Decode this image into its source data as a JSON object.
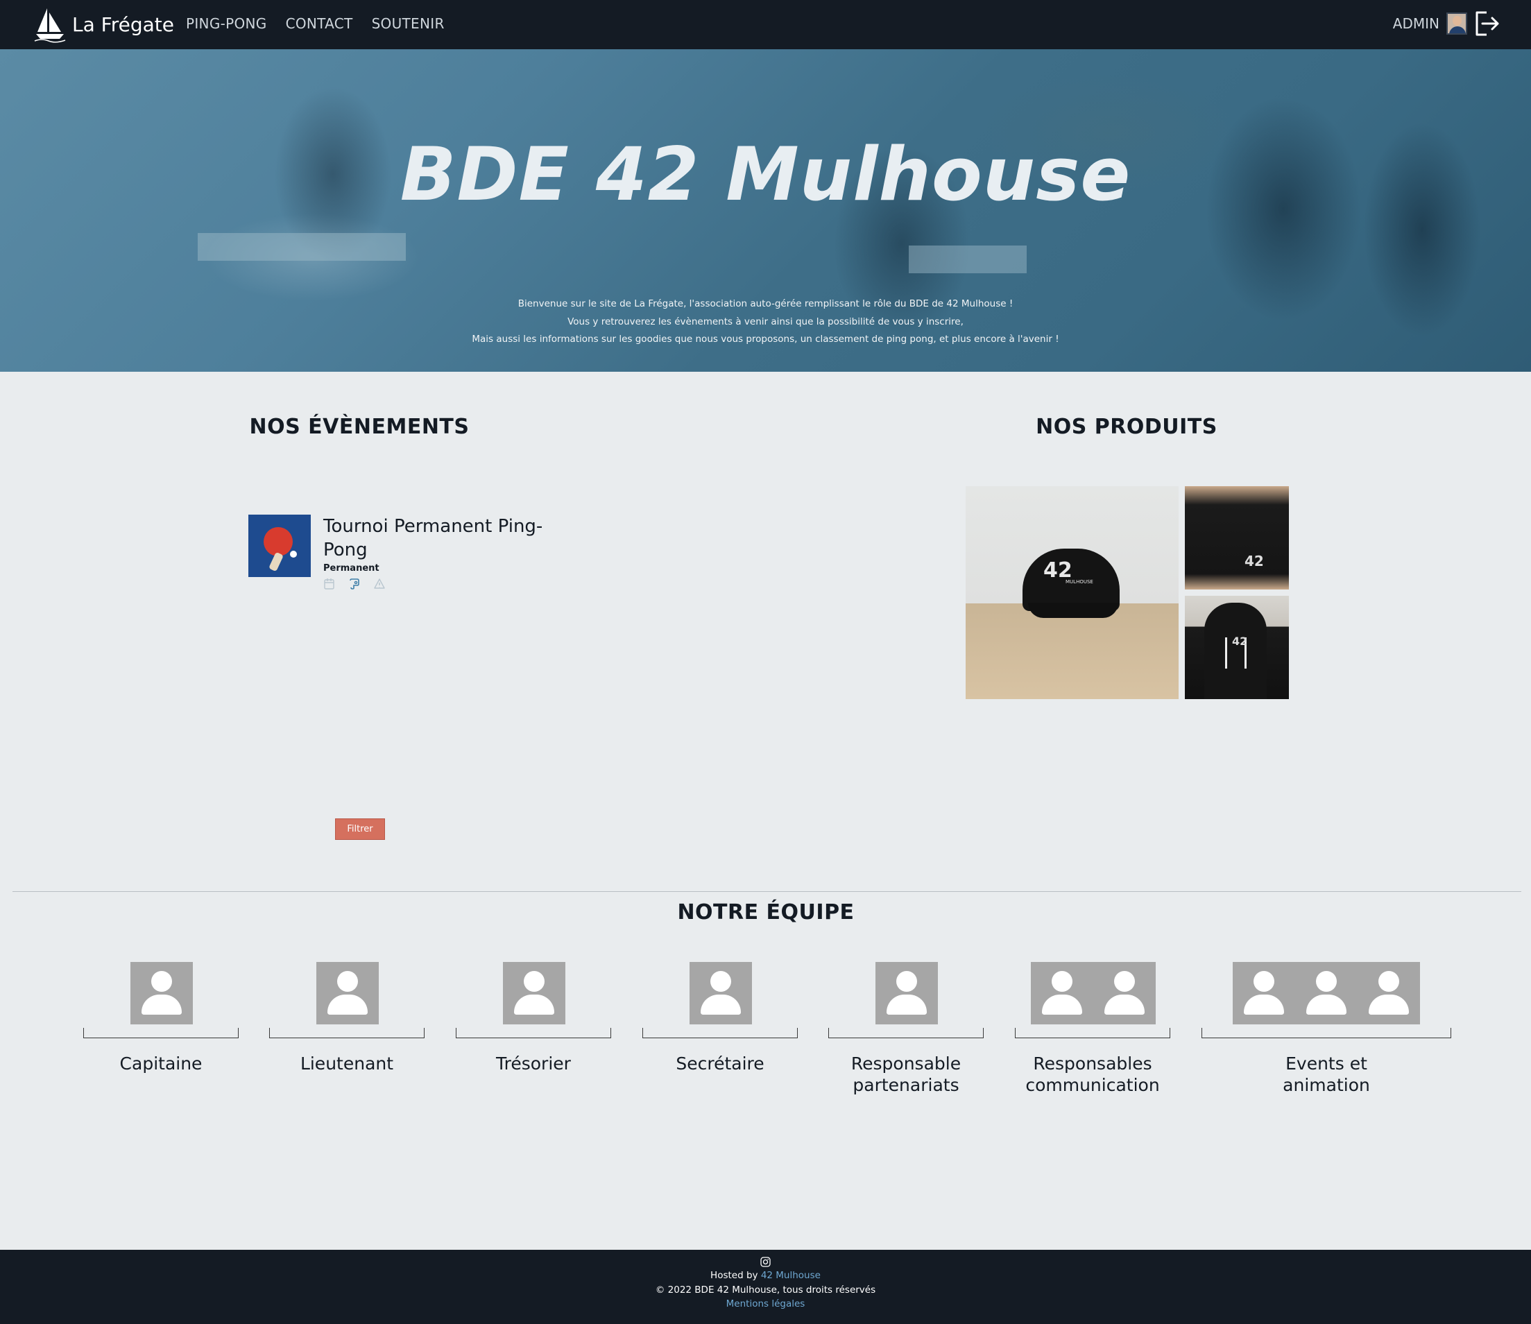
{
  "nav": {
    "brand_name": "La Frégate",
    "links": [
      "PING-PONG",
      "CONTACT",
      "SOUTENIR"
    ],
    "admin_label": "ADMIN"
  },
  "hero": {
    "title": "BDE 42 Mulhouse",
    "lines": [
      "Bienvenue sur le site de La Frégate, l'association auto-gérée remplissant le rôle du BDE de 42 Mulhouse !",
      "Vous y retrouverez les évènements à venir ainsi que la possibilité de vous y inscrire,",
      "Mais aussi les informations sur les goodies que nous vous proposons, un classement de ping pong, et plus encore à l'avenir !"
    ]
  },
  "events": {
    "section_title": "NOS ÉVÈNEMENTS",
    "items": [
      {
        "title": "Tournoi Permanent Ping-Pong",
        "subtitle": "Permanent"
      }
    ],
    "filter_label": "Filtrer"
  },
  "products": {
    "section_title": "NOS PRODUITS",
    "cap_logo": "42",
    "cap_logo_sub": "MULHOUSE",
    "shirt_logo": "42",
    "hoodie_logo": "42"
  },
  "team": {
    "section_title": "NOTRE ÉQUIPE",
    "roles": [
      {
        "label": "Capitaine",
        "count": 1
      },
      {
        "label": "Lieutenant",
        "count": 1
      },
      {
        "label": "Trésorier",
        "count": 1
      },
      {
        "label": "Secrétaire",
        "count": 1
      },
      {
        "label": "Responsable partenariats",
        "count": 1
      },
      {
        "label": "Responsables communication",
        "count": 2
      },
      {
        "label": "Events et animation",
        "count": 3
      }
    ]
  },
  "footer": {
    "hosted_prefix": "Hosted by ",
    "hosted_link": "42 Mulhouse",
    "copyright": "© 2022 BDE 42 Mulhouse, tous droits réservés",
    "legal_link": "Mentions légales"
  },
  "colors": {
    "nav_bg": "#141b24",
    "page_bg": "#e9ecee",
    "hero_tint": "#4e7f9b",
    "filter_button": "#d5705e",
    "link": "#6fa8d2",
    "avatar_placeholder": "#a6a6a6"
  }
}
